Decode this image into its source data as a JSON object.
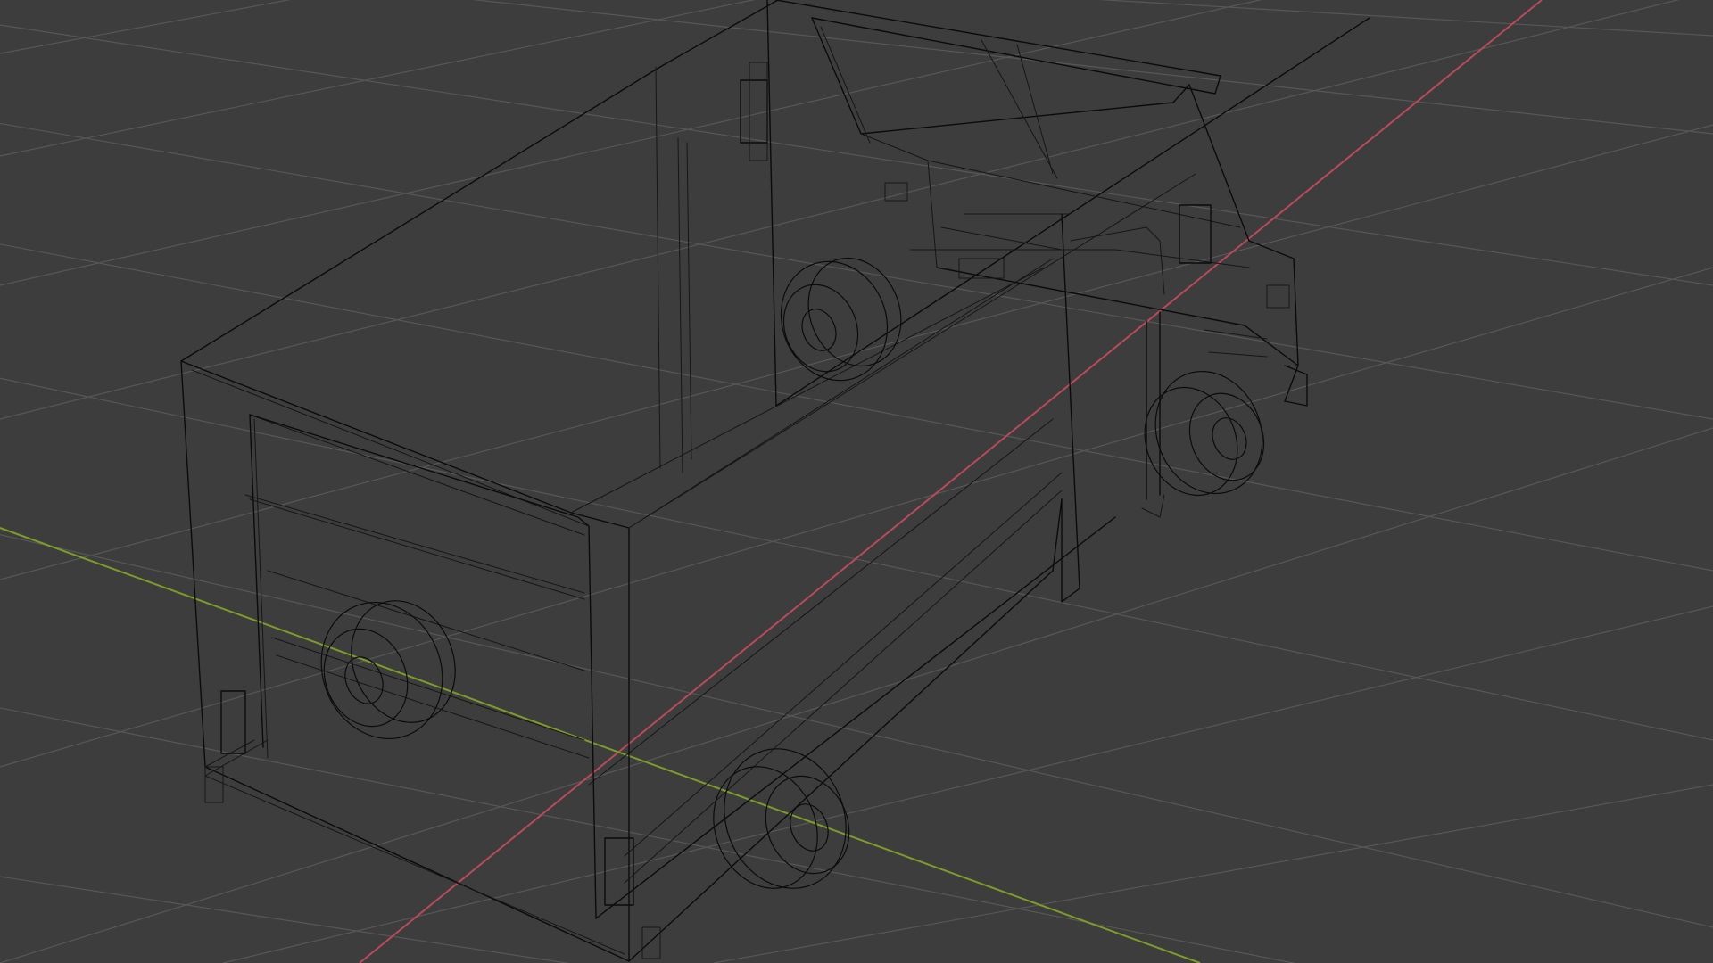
{
  "viewport": {
    "mode": "wireframe",
    "colors": {
      "background": "#3d3d3d",
      "grid": "#575757",
      "x_axis": "#b84a5c",
      "y_axis": "#7c9c2a",
      "wire": "#0b0b0b"
    }
  },
  "scene": {
    "object": "box-truck",
    "wheel_count": 4
  }
}
